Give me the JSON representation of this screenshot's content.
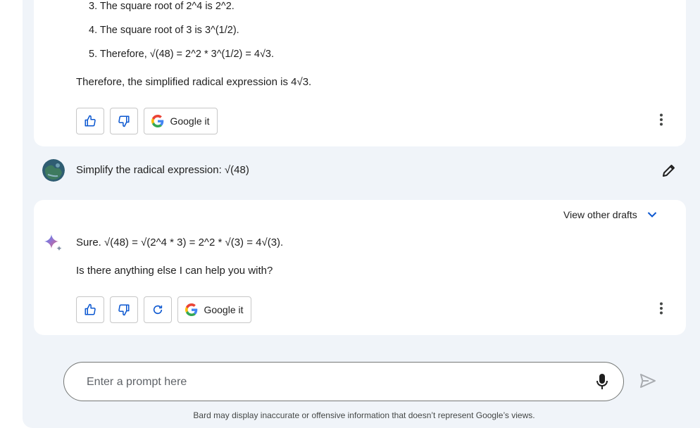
{
  "previous_response": {
    "steps": [
      "3. The square root of 2^4 is 2^2.",
      "4. The square root of 3 is 3^(1/2).",
      "5. Therefore, √(48) = 2^2 * 3^(1/2) = 4√3."
    ],
    "conclusion": "Therefore, the simplified radical expression is 4√3.",
    "google_it_label": "Google it"
  },
  "user_turn": {
    "query": "Simplify the radical expression: √(48)"
  },
  "response": {
    "view_drafts_label": "View other drafts",
    "answer": "Sure. √(48) = √(2^4 * 3) = 2^2 * √(3) = 4√(3).",
    "followup": "Is there anything else I can help you with?",
    "google_it_label": "Google it"
  },
  "input": {
    "placeholder": "Enter a prompt here",
    "value": ""
  },
  "footer": {
    "disclaimer": "Bard may display inaccurate or offensive information that doesn’t represent Google’s views."
  },
  "colors": {
    "accent": "#0b57d0",
    "background": "#f0f4f9",
    "card": "#ffffff",
    "border": "#c7c7c7"
  },
  "icons": [
    "thumbs-up-icon",
    "thumbs-down-icon",
    "google-g-icon",
    "more-vert-icon",
    "avatar-icon",
    "pencil-icon",
    "chevron-down-icon",
    "bard-sparkle-icon",
    "refresh-icon",
    "mic-icon",
    "send-icon"
  ]
}
